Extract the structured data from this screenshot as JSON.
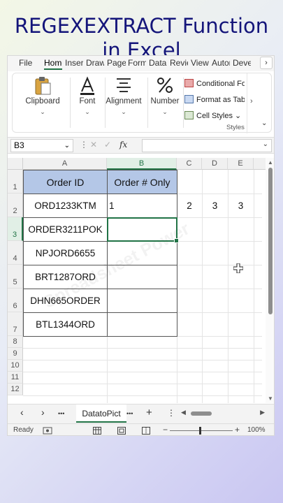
{
  "headline": {
    "line1": "REGEXEXTRACT Function",
    "line2": "in Excel"
  },
  "menu": {
    "tabs": [
      {
        "label": "File"
      },
      {
        "label": "Home"
      },
      {
        "label": "Insert"
      },
      {
        "label": "Draw"
      },
      {
        "label": "Page"
      },
      {
        "label": "Formulas"
      },
      {
        "label": "Data"
      },
      {
        "label": "Review"
      },
      {
        "label": "View"
      },
      {
        "label": "Automate"
      },
      {
        "label": "Developer"
      }
    ],
    "more": "›"
  },
  "ribbon": {
    "clipboard": "Clipboard",
    "font": "Font",
    "alignment": "Alignment",
    "number": "Number",
    "chevron": "⌄",
    "styles": {
      "conditional": "Conditional Formatting",
      "format_table": "Format as Table",
      "cell_styles": "Cell Styles",
      "cell_styles_caret": "⌄",
      "label": "Styles"
    },
    "expand": "›",
    "collapse": "⌄"
  },
  "formula_bar": {
    "name_box": "B3",
    "dropdown": "⌄",
    "options": "⋮",
    "cancel": "✕",
    "enter": "✓",
    "fx": "fx",
    "value": ""
  },
  "grid": {
    "columns": [
      "A",
      "B",
      "C",
      "D",
      "E"
    ],
    "rows": [
      "1",
      "2",
      "3",
      "4",
      "5",
      "6",
      "7",
      "8",
      "9",
      "10",
      "11",
      "12"
    ],
    "headers": {
      "a1": "Order ID",
      "b1": "Order # Only"
    },
    "order_ids": [
      "ORD1233KTM",
      "ORDER3211POK",
      "NPJORD6655",
      "BRT1287ORD",
      "DHN665ORDER",
      "BTL1344ORD"
    ],
    "b2": "1",
    "c2": "2",
    "d2": "3",
    "e2": "3",
    "watermark": "Spreadsheet Power",
    "scroll_up": "▲",
    "scroll_down": "▼"
  },
  "sheet_tabs": {
    "prev": "‹",
    "next": "›",
    "more_left": "•••",
    "sheet_name": "DatatoPict",
    "more_right": "•••",
    "add": "+",
    "options": "⋮",
    "hs_left": "◀",
    "hs_right": "▶"
  },
  "status": {
    "ready": "Ready",
    "zoom_minus": "−",
    "zoom_plus": "+",
    "zoom": "100%"
  },
  "colors": {
    "accent": "#217346",
    "header_fill": "#b4c7e7",
    "headline": "#14157a"
  }
}
